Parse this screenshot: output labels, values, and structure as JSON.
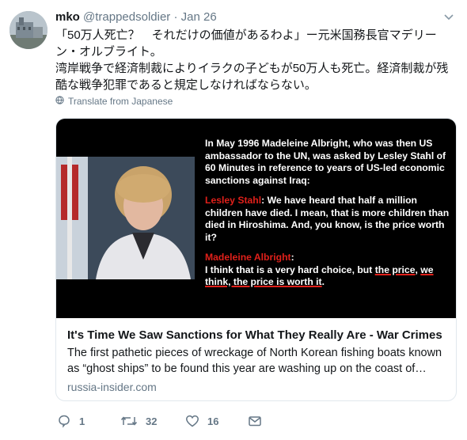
{
  "tweet": {
    "name": "mko",
    "handle": "@trappedsoldier",
    "separator": "·",
    "date": "Jan 26",
    "text_line1": "「50万人死亡？　それだけの価値があるわよ」ー元米国務長官マデリーン・オルブライト。",
    "text_line2": "湾岸戦争で経済制裁によりイラクの子どもが50万人も死亡。経済制裁が残酷な戦争犯罪であると規定しなければならない。",
    "translate_label": "Translate from Japanese"
  },
  "card": {
    "image_quote": {
      "intro": "In May 1996 Madeleine Albright, who was then US ambassador to the UN, was asked by Lesley Stahl of 60 Minutes in reference to years of US-led economic sanctions against Iraq:",
      "speaker1": "Lesley Stahl",
      "quote1": ": We have heard that half a million children have died. I mean, that is more children than died in Hiroshima. And, you know, is the price worth it?",
      "speaker2": "Madeleine Albright",
      "quote2_colon": ":",
      "quote2_a": " I think that is a very hard choice, but ",
      "quote2_hl1": "the price",
      "quote2_b": ", ",
      "quote2_hl2": "we think, the price is worth it",
      "quote2_end": "."
    },
    "title": "It's Time We Saw Sanctions for What They Really Are - War Crimes",
    "description": "The first pathetic pieces of wreckage of North Korean fishing boats known as “ghost ships” to be found this year are washing up on the coast of northern Japan...",
    "domain": "russia-insider.com"
  },
  "actions": {
    "reply_count": "1",
    "retweet_count": "32",
    "like_count": "16"
  },
  "colors": {
    "text": "#14171a",
    "secondary": "#657786",
    "border": "#e1e8ed",
    "quote_red": "#e0201a"
  }
}
